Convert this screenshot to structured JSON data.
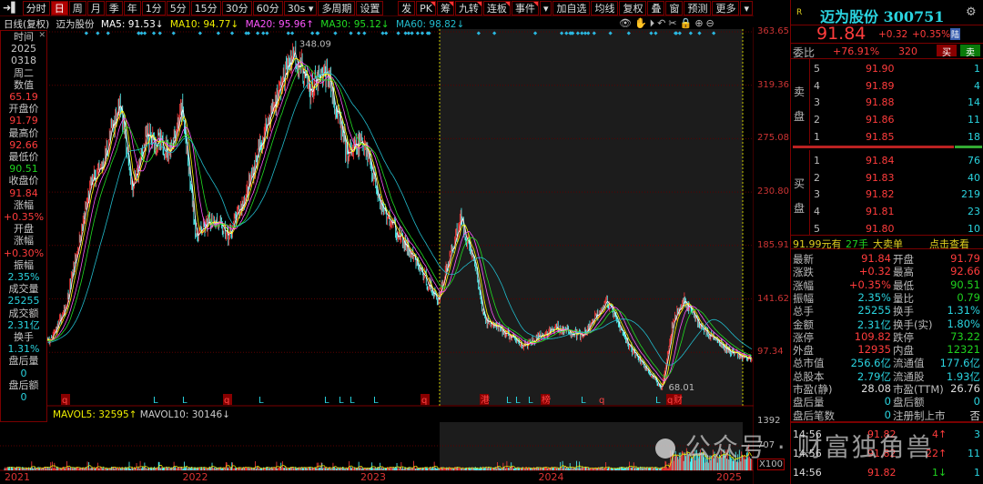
{
  "toolbar": {
    "items": [
      "分时",
      "日",
      "周",
      "月",
      "季",
      "年",
      "1分",
      "5分",
      "15分",
      "30分",
      "60分",
      "30s ▾",
      "多周期",
      "设置"
    ],
    "active": "日",
    "right_items": [
      "发",
      "PK",
      "筹",
      "九转",
      "连板",
      "事件",
      "▾",
      "加自选",
      "均线",
      "复权",
      "叠",
      "窗",
      "预测",
      "更多",
      "▾"
    ]
  },
  "legend": {
    "mode": "日线(复权)",
    "name": "迈为股份",
    "ma5": "MA5: 91.53↓",
    "ma10": "MA10: 94.77↓",
    "ma20": "MA20: 95.96↑",
    "ma30": "MA30: 95.12↓",
    "ma60": "MA60: 98.82↓"
  },
  "tool_icons": [
    "eye-icon",
    "hand-icon",
    "play-icon",
    "undo-icon",
    "scissors-icon",
    "lock-icon",
    "zoom-in-icon",
    "zoom-out-icon"
  ],
  "info_panel": [
    [
      "时间",
      "l"
    ],
    [
      "2025",
      "l"
    ],
    [
      "0318",
      "l"
    ],
    [
      "周二",
      "l"
    ],
    [
      "数值",
      "l"
    ],
    [
      "65.19",
      "r"
    ],
    [
      "开盘价",
      "l"
    ],
    [
      "91.79",
      "r"
    ],
    [
      "最高价",
      "l"
    ],
    [
      "92.66",
      "r"
    ],
    [
      "最低价",
      "l"
    ],
    [
      "90.51",
      "g"
    ],
    [
      "收盘价",
      "l"
    ],
    [
      "91.84",
      "r"
    ],
    [
      "涨幅",
      "l"
    ],
    [
      "+0.35%",
      "r"
    ],
    [
      "开盘",
      "l"
    ],
    [
      "涨幅",
      "l"
    ],
    [
      "+0.30%",
      "r"
    ],
    [
      "振幅",
      "l"
    ],
    [
      "2.35%",
      "c"
    ],
    [
      "成交量",
      "l"
    ],
    [
      "25255",
      "c"
    ],
    [
      "成交额",
      "l"
    ],
    [
      "2.31亿",
      "c"
    ],
    [
      "换手",
      "l"
    ],
    [
      "1.31%",
      "c"
    ],
    [
      "盘后量",
      "l"
    ],
    [
      "0",
      "c"
    ],
    [
      "盘后额",
      "l"
    ],
    [
      "0",
      "c"
    ]
  ],
  "price_axis": [
    "363.65",
    "319.36",
    "275.08",
    "230.80",
    "185.91",
    "141.62",
    "97.34"
  ],
  "annotations": {
    "high": "348.09",
    "low": "68.01"
  },
  "markers": [
    "q",
    "L",
    "L",
    "q",
    "L",
    "L",
    "L",
    "L",
    "L",
    "q",
    "港",
    "L",
    "L",
    "L",
    "榜",
    "L",
    "q",
    "L",
    "q",
    "财"
  ],
  "volume_legend": {
    "mavol5": "MAVOL5: 32595↑",
    "mavol10": "MAVOL10: 30146↓"
  },
  "volume_axis": [
    "1392",
    "707",
    "X100"
  ],
  "years": [
    "2021",
    "2022",
    "2023",
    "2024",
    "2025"
  ],
  "colors": {
    "up": "#ff3c3c",
    "down": "#54ffff",
    "ma5": "#ffffff",
    "ma10": "#ffff00",
    "ma20": "#ff55ff",
    "ma30": "#22dd22",
    "ma60": "#22bbcc"
  },
  "chart_data": {
    "type": "candlestick",
    "title": "迈为股份 日线(复权)",
    "ylim": [
      60,
      363.65
    ],
    "keypoints": [
      [
        2021.0,
        100
      ],
      [
        2021.12,
        108
      ],
      [
        2021.26,
        107
      ],
      [
        2021.34,
        133
      ],
      [
        2021.49,
        239
      ],
      [
        2021.54,
        247
      ],
      [
        2021.65,
        307
      ],
      [
        2021.72,
        232
      ],
      [
        2021.8,
        277
      ],
      [
        2021.93,
        266
      ],
      [
        2022.0,
        299
      ],
      [
        2022.08,
        194
      ],
      [
        2022.18,
        209
      ],
      [
        2022.26,
        194
      ],
      [
        2022.36,
        228
      ],
      [
        2022.47,
        284
      ],
      [
        2022.63,
        348.09
      ],
      [
        2022.72,
        315
      ],
      [
        2022.82,
        330
      ],
      [
        2022.93,
        262
      ],
      [
        2023.03,
        273
      ],
      [
        2023.13,
        217
      ],
      [
        2023.34,
        167
      ],
      [
        2023.44,
        141
      ],
      [
        2023.57,
        209
      ],
      [
        2023.65,
        171
      ],
      [
        2023.7,
        126
      ],
      [
        2023.93,
        103
      ],
      [
        2024.11,
        118
      ],
      [
        2024.26,
        111
      ],
      [
        2024.39,
        141
      ],
      [
        2024.52,
        103
      ],
      [
        2024.7,
        68.01
      ],
      [
        2024.77,
        126
      ],
      [
        2024.83,
        141
      ],
      [
        2024.93,
        118
      ],
      [
        2025.08,
        99
      ],
      [
        2025.21,
        91.84
      ]
    ]
  },
  "quote": {
    "code_name": "迈为股份 300751",
    "price": "91.84",
    "change": "+0.32",
    "pct": "+0.35%",
    "badge": "陆",
    "r": "R",
    "weibi_label": "委比",
    "weibi": "+76.91%",
    "weicha": "320",
    "buy": "买",
    "sell": "卖",
    "ask_label": [
      "卖",
      "盘"
    ],
    "bid_label": [
      "买",
      "盘"
    ],
    "asks": [
      [
        "5",
        "91.90",
        "1"
      ],
      [
        "4",
        "91.89",
        "4"
      ],
      [
        "3",
        "91.88",
        "14"
      ],
      [
        "2",
        "91.86",
        "11"
      ],
      [
        "1",
        "91.85",
        "18"
      ]
    ],
    "bids": [
      [
        "1",
        "91.84",
        "76"
      ],
      [
        "2",
        "91.83",
        "40"
      ],
      [
        "3",
        "91.82",
        "219"
      ],
      [
        "4",
        "91.81",
        "23"
      ],
      [
        "5",
        "91.80",
        "10"
      ]
    ],
    "big_order": {
      "price": "91.99元有",
      "qty": "27手",
      "type": "大卖单",
      "link": "点击查看"
    },
    "stats": [
      [
        "最新",
        "91.84",
        "r",
        "开盘",
        "91.79",
        "r"
      ],
      [
        "涨跌",
        "+0.32",
        "r",
        "最高",
        "92.66",
        "r"
      ],
      [
        "涨幅",
        "+0.35%",
        "r",
        "最低",
        "90.51",
        "g"
      ],
      [
        "振幅",
        "2.35%",
        "c",
        "量比",
        "0.79",
        "g"
      ],
      [
        "总手",
        "25255",
        "c",
        "换手",
        "1.31%",
        "c"
      ],
      [
        "金额",
        "2.31亿",
        "c",
        "换手(实)",
        "1.80%",
        "c"
      ],
      [
        "涨停",
        "109.82",
        "r",
        "跌停",
        "73.22",
        "g"
      ],
      [
        "外盘",
        "12935",
        "r",
        "内盘",
        "12321",
        "g"
      ],
      [
        "总市值",
        "256.6亿",
        "c",
        "流通值",
        "177.6亿",
        "c"
      ],
      [
        "总股本",
        "2.79亿",
        "c",
        "流通股",
        "1.93亿",
        "c"
      ],
      [
        "市盈(静)",
        "28.08",
        "w",
        "市盈(TTM)",
        "26.76",
        "w"
      ],
      [
        "盘后量",
        "0",
        "c",
        "盘后额",
        "0",
        "c"
      ],
      [
        "盘后笔数",
        "0",
        "c",
        "注册制上市",
        "否",
        "w"
      ]
    ],
    "ticks": [
      [
        "14:56",
        "91.82",
        "4",
        "↑",
        "3"
      ],
      [
        "14:56",
        "91.82",
        "22",
        "↑",
        "11"
      ],
      [
        "14:56",
        "91.82",
        "1",
        "↓",
        "1"
      ]
    ]
  },
  "watermark": "公众号 · 财富独角兽"
}
